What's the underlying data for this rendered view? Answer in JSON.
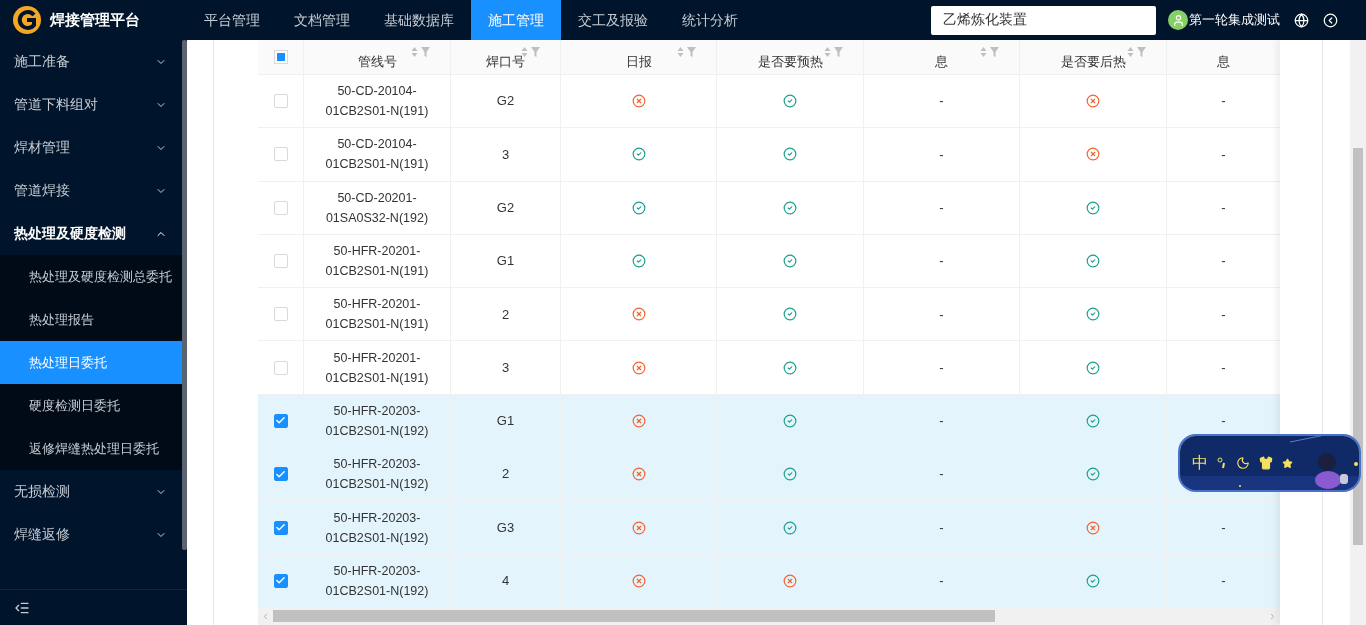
{
  "app": {
    "title": "焊接管理平台"
  },
  "nav": [
    {
      "label": "平台管理",
      "selected": false
    },
    {
      "label": "文档管理",
      "selected": false
    },
    {
      "label": "基础数据库",
      "selected": false
    },
    {
      "label": "施工管理",
      "selected": true
    },
    {
      "label": "交工及报验",
      "selected": false
    },
    {
      "label": "统计分析",
      "selected": false
    }
  ],
  "search": {
    "value": "乙烯炼化装置"
  },
  "user": {
    "name": "第一轮集成测试"
  },
  "sidebar": {
    "items": [
      {
        "label": "施工准备",
        "expanded": false
      },
      {
        "label": "管道下料组对",
        "expanded": false
      },
      {
        "label": "焊材管理",
        "expanded": false
      },
      {
        "label": "管道焊接",
        "expanded": false
      },
      {
        "label": "热处理及硬度检测",
        "expanded": true,
        "children": [
          {
            "label": "热处理及硬度检测总委托",
            "selected": false
          },
          {
            "label": "热处理报告",
            "selected": false
          },
          {
            "label": "热处理日委托",
            "selected": true
          },
          {
            "label": "硬度检测日委托",
            "selected": false
          },
          {
            "label": "返修焊缝热处理日委托",
            "selected": false
          }
        ]
      },
      {
        "label": "无损检测",
        "expanded": false
      },
      {
        "label": "焊缝返修",
        "expanded": false
      }
    ]
  },
  "table": {
    "select_all": {
      "indeterminate": true
    },
    "columns": [
      "管线号",
      "焊口号",
      "日报",
      "是否要预热",
      "息",
      "是否要后热",
      "息"
    ],
    "rows": [
      {
        "checked": false,
        "pipeline": [
          "50-CD-20104-",
          "01CB2S01-N(191)"
        ],
        "weld": "G2",
        "daily": false,
        "preheat": true,
        "column_5": "-",
        "postheat": false,
        "column_7": "-"
      },
      {
        "checked": false,
        "pipeline": [
          "50-CD-20104-",
          "01CB2S01-N(191)"
        ],
        "weld": "3",
        "daily": true,
        "preheat": true,
        "column_5": "-",
        "postheat": false,
        "column_7": "-"
      },
      {
        "checked": false,
        "pipeline": [
          "50-CD-20201-",
          "01SA0S32-N(192)"
        ],
        "weld": "G2",
        "daily": true,
        "preheat": true,
        "column_5": "-",
        "postheat": true,
        "column_7": "-"
      },
      {
        "checked": false,
        "pipeline": [
          "50-HFR-20201-",
          "01CB2S01-N(191)"
        ],
        "weld": "G1",
        "daily": true,
        "preheat": true,
        "column_5": "-",
        "postheat": true,
        "column_7": "-"
      },
      {
        "checked": false,
        "pipeline": [
          "50-HFR-20201-",
          "01CB2S01-N(191)"
        ],
        "weld": "2",
        "daily": false,
        "preheat": true,
        "column_5": "-",
        "postheat": true,
        "column_7": "-"
      },
      {
        "checked": false,
        "pipeline": [
          "50-HFR-20201-",
          "01CB2S01-N(191)"
        ],
        "weld": "3",
        "daily": false,
        "preheat": true,
        "column_5": "-",
        "postheat": true,
        "column_7": "-"
      },
      {
        "checked": true,
        "pipeline": [
          "50-HFR-20203-",
          "01CB2S01-N(192)"
        ],
        "weld": "G1",
        "daily": false,
        "preheat": true,
        "column_5": "-",
        "postheat": true,
        "column_7": "-"
      },
      {
        "checked": true,
        "pipeline": [
          "50-HFR-20203-",
          "01CB2S01-N(192)"
        ],
        "weld": "2",
        "daily": false,
        "preheat": true,
        "column_5": "-",
        "postheat": true
      },
      {
        "checked": true,
        "pipeline": [
          "50-HFR-20203-",
          "01CB2S01-N(192)"
        ],
        "weld": "G3",
        "daily": false,
        "preheat": true,
        "column_5": "-",
        "postheat": false,
        "column_7": "-"
      },
      {
        "checked": true,
        "pipeline": [
          "50-HFR-20203-",
          "01CB2S01-N(192)"
        ],
        "weld": "4",
        "daily": false,
        "preheat": false,
        "column_5": "-",
        "postheat": true,
        "column_7": "-"
      }
    ]
  },
  "ime": {
    "label": "中"
  }
}
